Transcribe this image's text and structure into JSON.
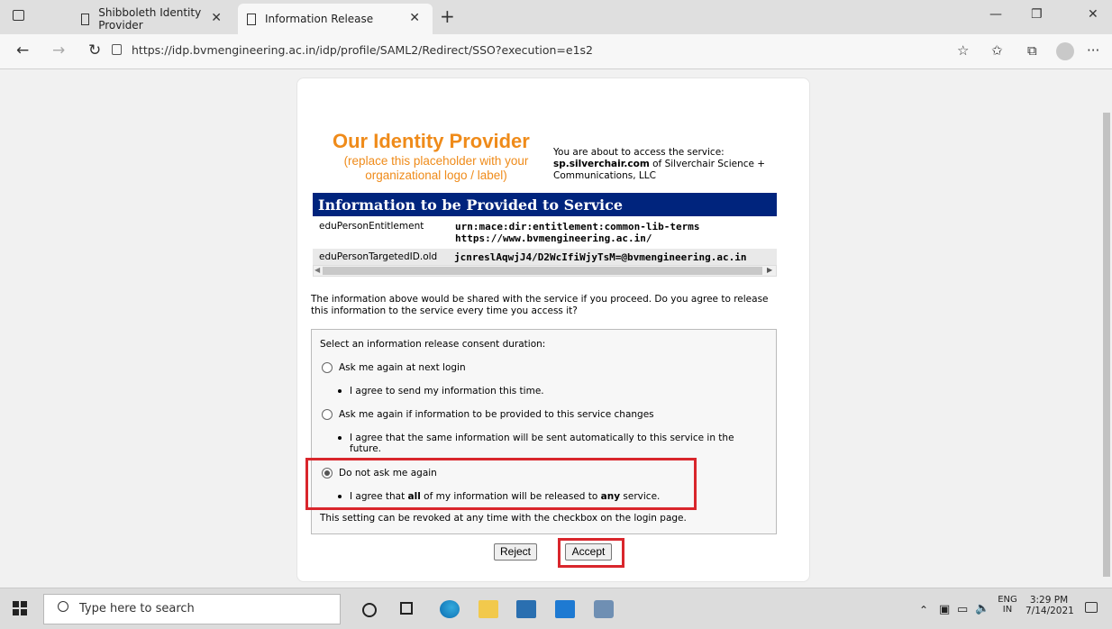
{
  "browser": {
    "tabs": [
      {
        "title": "Shibboleth Identity Provider",
        "active": false
      },
      {
        "title": "Information Release",
        "active": true
      }
    ],
    "url": "https://idp.bvmengineering.ac.in/idp/profile/SAML2/Redirect/SSO?execution=e1s2"
  },
  "page": {
    "logo_title": "Our Identity Provider",
    "logo_sub_line1": "(replace this placeholder with your",
    "logo_sub_line2": "organizational logo / label)",
    "access_line1": "You are about to access the service:",
    "service_name": "sp.silverchair.com",
    "access_line2_rest": " of Silverchair Science +",
    "access_line3": "Communications, LLC",
    "info_header": "Information to be Provided to Service",
    "attributes": [
      {
        "name": "eduPersonEntitlement",
        "value_line1": "urn:mace:dir:entitlement:common-lib-terms",
        "value_line2": "https://www.bvmengineering.ac.in/"
      },
      {
        "name": "eduPersonTargetedID.old",
        "value_line1": "jcnreslAqwjJ4/D2WcIfiWjyTsM=@bvmengineering.ac.in",
        "value_line2": ""
      }
    ],
    "question_line1": "The information above would be shared with the service if you proceed. Do you agree to release",
    "question_line2": "this information to the service every time you access it?",
    "consent": {
      "heading": "Select an information release consent duration:",
      "options": [
        {
          "label": "Ask me again at next login",
          "detail": "I agree to send my information this time.",
          "detail2": "",
          "selected": false
        },
        {
          "label": "Ask me again if information to be provided to this service changes",
          "detail": "I agree that the same information will be sent automatically to this service in the",
          "detail2": "future.",
          "selected": false
        },
        {
          "label": "Do not ask me again",
          "detail_pre": "I agree that ",
          "detail_b1": "all",
          "detail_mid": " of my information will be released to ",
          "detail_b2": "any",
          "detail_post": " service.",
          "selected": true
        }
      ],
      "footer": "This setting can be revoked at any time with the checkbox on the login page."
    },
    "reject_label": "Reject",
    "accept_label": "Accept"
  },
  "taskbar": {
    "search_placeholder": "Type here to search",
    "lang": "ENG",
    "region": "IN",
    "time": "3:29 PM",
    "date": "7/14/2021"
  },
  "colors": {
    "accent_header": "#00247d",
    "logo_orange": "#ef8b1a",
    "highlight_red": "#d9262c"
  }
}
